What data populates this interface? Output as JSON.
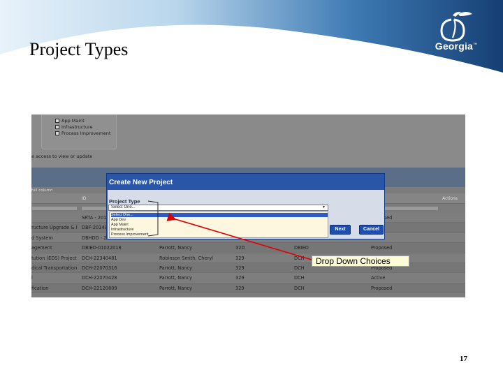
{
  "slide": {
    "title": "Project Types",
    "page_number": "17",
    "logo_text": "Georgia",
    "callout_label": "Drop Down Choices"
  },
  "colors": {
    "header_dark": "#1c4f86",
    "header_light": "#dcecf6",
    "modal_title_bar": "#2a56a8",
    "dropdown_background": "#fdf7e0",
    "selected_option": "#2f5cc4",
    "annotation_red": "#e00000",
    "callout_background": "#fcfcd8"
  },
  "background_app": {
    "filter_options": [
      "App Maint",
      "Infrastructure",
      "Process Improvement"
    ],
    "access_text": "e access to view or update",
    "grid_caption": "full column",
    "columns": [
      "ID",
      "Actions"
    ],
    "rows": [
      {
        "name": "",
        "id": "SRTA - 20140...",
        "manager": "",
        "code": "",
        "agency": "",
        "status": "Proposed"
      },
      {
        "name": "ructure Upgrade & IT ...",
        "id": "DBF-2014029",
        "manager": "",
        "code": "",
        "agency": "",
        "status": ""
      },
      {
        "name": "d System",
        "id": "DBHDD - 2014...",
        "manager": "",
        "code": "",
        "agency": "",
        "status": ""
      },
      {
        "name": "agement",
        "id": "DBIED-01022018",
        "manager": "Parrott, Nancy",
        "code": "32D",
        "agency": "DBIED",
        "status": "Proposed"
      },
      {
        "name": "tution (EDS) Project",
        "id": "DCH-22340481",
        "manager": "Robinson Smith, Cheryl",
        "code": "329",
        "agency": "DCH",
        "status": ""
      },
      {
        "name": "dical Transportation",
        "id": "DCH-22070316",
        "manager": "Parrott, Nancy",
        "code": "329",
        "agency": "DCH",
        "status": "Proposed"
      },
      {
        "name": "l",
        "id": "DCH-22070428",
        "manager": "Parrott, Nancy",
        "code": "329",
        "agency": "DCH",
        "status": "Active"
      },
      {
        "name": "fication",
        "id": "DCH-22120809",
        "manager": "Parrott, Nancy",
        "code": "329",
        "agency": "DCH",
        "status": "Proposed"
      }
    ]
  },
  "modal": {
    "title": "Create New Project",
    "field_label": "Project Type",
    "select_value": "Select One...",
    "options": [
      "Select One...",
      "App Dev",
      "App Maint",
      "Infrastructure",
      "Process Improvement"
    ],
    "selected_index": 0,
    "next_label": "Next",
    "cancel_label": "Cancel"
  }
}
